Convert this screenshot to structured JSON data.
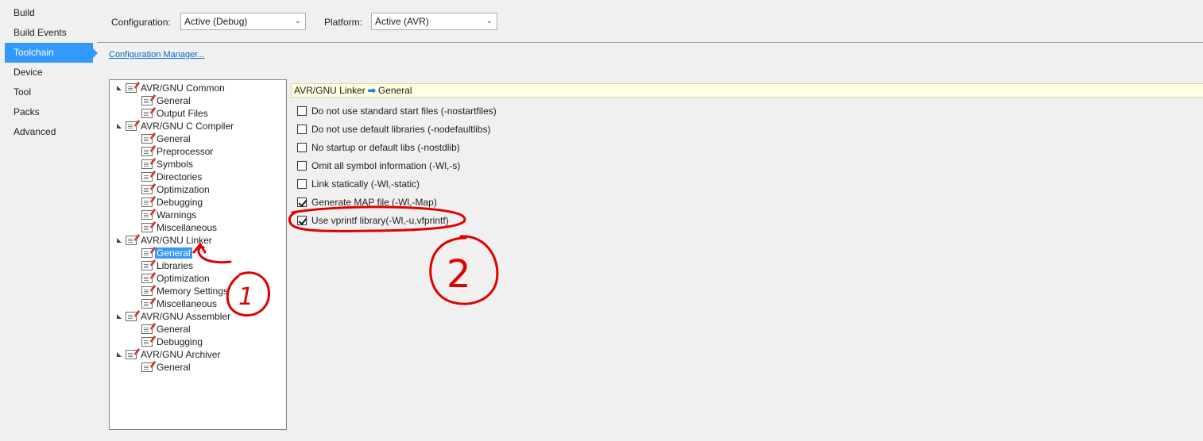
{
  "nav": {
    "items": [
      {
        "label": "Build"
      },
      {
        "label": "Build Events"
      },
      {
        "label": "Toolchain",
        "active": true
      },
      {
        "label": "Device"
      },
      {
        "label": "Tool"
      },
      {
        "label": "Packs"
      },
      {
        "label": "Advanced"
      }
    ]
  },
  "config": {
    "configuration_label": "Configuration:",
    "configuration_value": "Active (Debug)",
    "platform_label": "Platform:",
    "platform_value": "Active (AVR)",
    "manager_link": "Configuration Manager..."
  },
  "tree": {
    "groups": [
      {
        "label": "AVR/GNU Common",
        "children": [
          "General",
          "Output Files"
        ]
      },
      {
        "label": "AVR/GNU C Compiler",
        "children": [
          "General",
          "Preprocessor",
          "Symbols",
          "Directories",
          "Optimization",
          "Debugging",
          "Warnings",
          "Miscellaneous"
        ]
      },
      {
        "label": "AVR/GNU Linker",
        "children": [
          "General",
          "Libraries",
          "Optimization",
          "Memory Settings",
          "Miscellaneous"
        ]
      },
      {
        "label": "AVR/GNU Assembler",
        "children": [
          "General",
          "Debugging"
        ]
      },
      {
        "label": "AVR/GNU Archiver",
        "children": [
          "General"
        ]
      }
    ],
    "selected": "AVR/GNU Linker > General"
  },
  "breadcrumb": {
    "parent": "AVR/GNU Linker",
    "arrow": "➡",
    "current": "General"
  },
  "options": [
    {
      "label": "Do not use standard start files (-nostartfiles)",
      "checked": false
    },
    {
      "label": "Do not use default libraries (-nodefaultlibs)",
      "checked": false
    },
    {
      "label": "No startup or default libs (-nostdlib)",
      "checked": false
    },
    {
      "label": "Omit all symbol information (-Wl,-s)",
      "checked": false
    },
    {
      "label": "Link statically (-Wl,-static)",
      "checked": false
    },
    {
      "label": "Generate MAP file (-Wl,-Map)",
      "checked": true
    },
    {
      "label": "Use vprintf library(-Wl,-u,vfprintf)",
      "checked": true
    }
  ],
  "annotations": {
    "marker_1": "1",
    "marker_2": "2",
    "color": "#e00000"
  }
}
